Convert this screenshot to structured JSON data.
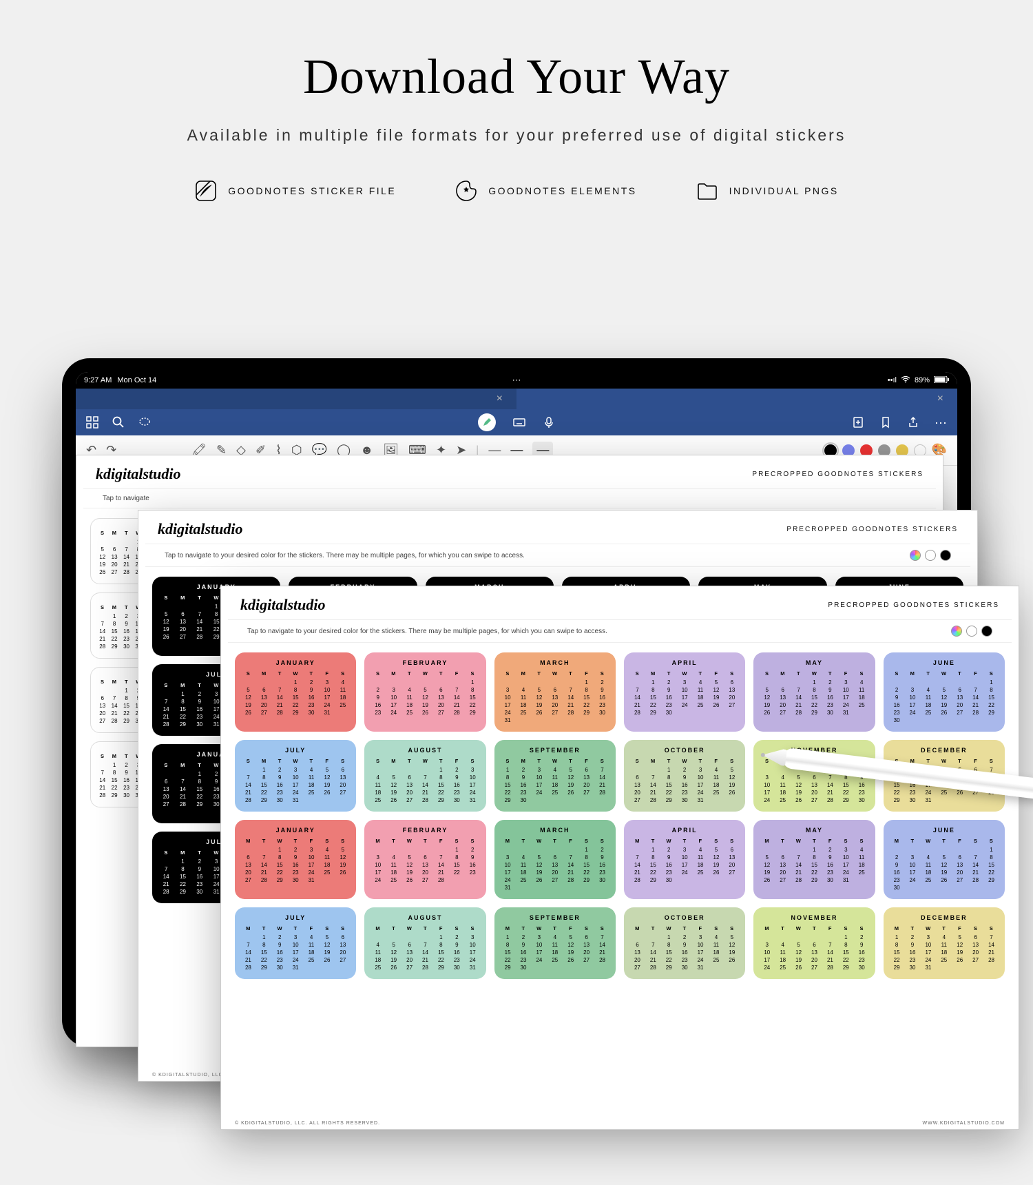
{
  "hero": {
    "title": "Download Your Way",
    "subtitle": "Available in multiple file formats for your preferred use of digital stickers"
  },
  "formats": [
    {
      "label": "GOODNOTES STICKER FILE"
    },
    {
      "label": "GOODNOTES ELEMENTS"
    },
    {
      "label": "INDIVIDUAL PNGS"
    }
  ],
  "ipad": {
    "time": "9:27 AM",
    "date": "Mon Oct 14",
    "battery": "89%"
  },
  "sheet": {
    "brand": "kdigitalstudio",
    "tag": "PRECROPPED GOODNOTES STICKERS",
    "instruct": "Tap to navigate to your desired color for the stickers. There may be multiple pages, for which you can swipe to access.",
    "footer_left": "© KDIGITALSTUDIO, LLC. ALL RIGHTS RESERVED.",
    "footer_right": "WWW.KDIGITALSTUDIO.COM"
  },
  "dow_sun": [
    "S",
    "M",
    "T",
    "W",
    "T",
    "F",
    "S"
  ],
  "dow_mon": [
    "M",
    "T",
    "W",
    "T",
    "F",
    "S",
    "S"
  ],
  "months": [
    "JANUARY",
    "FEBRUARY",
    "MARCH",
    "APRIL",
    "MAY",
    "JUNE",
    "JULY",
    "AUGUST",
    "SEPTEMBER",
    "OCTOBER",
    "NOVEMBER",
    "DECEMBER"
  ],
  "row1": [
    {
      "m": "JANUARY",
      "color": "#ec7b78",
      "start": 3,
      "len": 31
    },
    {
      "m": "FEBRUARY",
      "color": "#f29fb0",
      "start": 6,
      "len": 29
    },
    {
      "m": "MARCH",
      "color": "#f0a97a",
      "start": 5,
      "len": 31
    },
    {
      "m": "APRIL",
      "color": "#c9b6e4",
      "start": 1,
      "len": 30
    },
    {
      "m": "MAY",
      "color": "#beb0e0",
      "start": 3,
      "len": 31
    },
    {
      "m": "JUNE",
      "color": "#a9b8eb",
      "start": 6,
      "len": 30
    }
  ],
  "row2": [
    {
      "m": "JULY",
      "color": "#9ec5ef",
      "start": 1,
      "len": 31
    },
    {
      "m": "AUGUST",
      "color": "#aedbc9",
      "start": 4,
      "len": 31
    },
    {
      "m": "SEPTEMBER",
      "color": "#90c9a0",
      "start": 0,
      "len": 30
    },
    {
      "m": "OCTOBER",
      "color": "#c7d8b0",
      "start": 2,
      "len": 31
    },
    {
      "m": "NOVEMBER",
      "color": "#d5e59a",
      "start": 5,
      "len": 30
    },
    {
      "m": "DECEMBER",
      "color": "#e9dd9a",
      "start": 0,
      "len": 31
    }
  ],
  "row3": [
    {
      "m": "JANUARY",
      "color": "#ec7b78",
      "start": 2,
      "len": 31
    },
    {
      "m": "FEBRUARY",
      "color": "#f29fb0",
      "start": 5,
      "len": 28
    },
    {
      "m": "MARCH",
      "color": "#84c49a",
      "start": 5,
      "len": 31
    },
    {
      "m": "APRIL",
      "color": "#c9b6e4",
      "start": 1,
      "len": 30
    },
    {
      "m": "MAY",
      "color": "#beb0e0",
      "start": 3,
      "len": 31
    },
    {
      "m": "JUNE",
      "color": "#a9b8eb",
      "start": 6,
      "len": 30
    }
  ],
  "row4": [
    {
      "m": "JULY",
      "color": "#9ec5ef",
      "start": 1,
      "len": 31
    },
    {
      "m": "AUGUST",
      "color": "#aedbc9",
      "start": 4,
      "len": 31
    },
    {
      "m": "SEPTEMBER",
      "color": "#90c9a0",
      "start": 0,
      "len": 30
    },
    {
      "m": "OCTOBER",
      "color": "#c7d8b0",
      "start": 2,
      "len": 31
    },
    {
      "m": "NOVEMBER",
      "color": "#d5e59a",
      "start": 5,
      "len": 30
    },
    {
      "m": "DECEMBER",
      "color": "#e9dd9a",
      "start": 0,
      "len": 31
    }
  ]
}
